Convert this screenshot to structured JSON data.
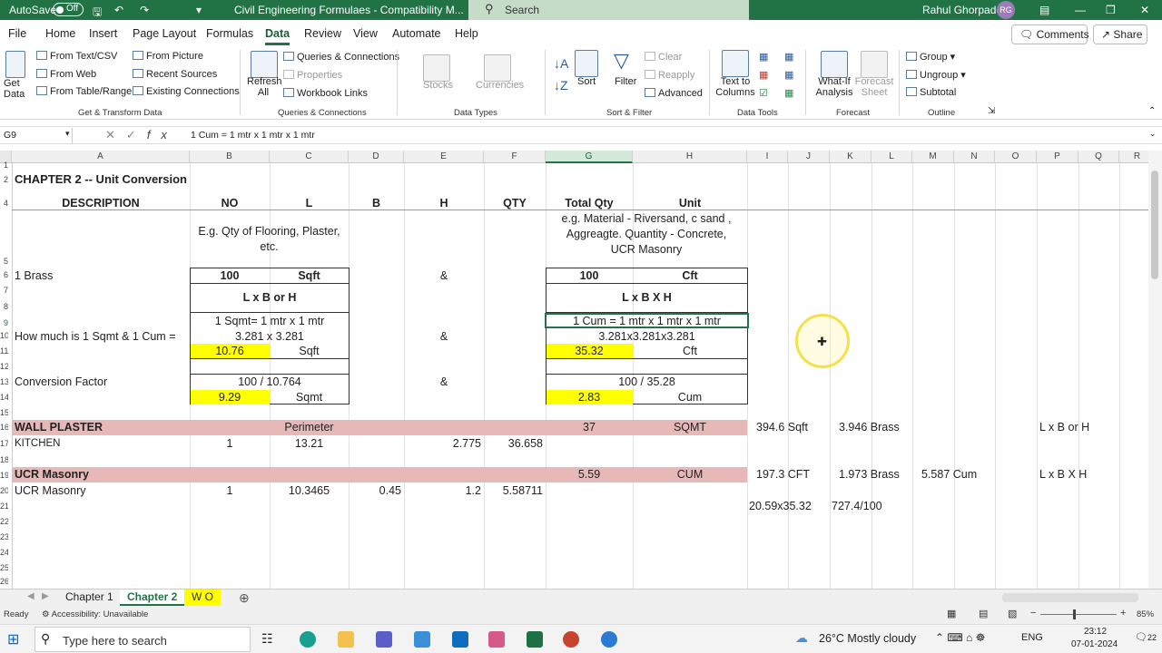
{
  "titlebar": {
    "autosave_label": "AutoSave",
    "autosave_state": "Off",
    "doc_title": "Civil Engineering Formulaes  -  Compatibility M...",
    "search_placeholder": "Search",
    "user_name": "Rahul  Ghorpade",
    "user_initials": "RG"
  },
  "menu": {
    "items": [
      "File",
      "Home",
      "Insert",
      "Page Layout",
      "Formulas",
      "Data",
      "Review",
      "View",
      "Automate",
      "Help"
    ],
    "active": "Data",
    "comments_label": "Comments",
    "share_label": "Share"
  },
  "ribbon": {
    "get_data": "Get Data",
    "from_text": "From Text/CSV",
    "from_web": "From Web",
    "from_table": "From Table/Range",
    "from_picture": "From Picture",
    "recent_sources": "Recent Sources",
    "existing_connections": "Existing Connections",
    "group_get_transform": "Get & Transform Data",
    "refresh_all": "Refresh All",
    "queries_connections": "Queries & Connections",
    "properties": "Properties",
    "workbook_links": "Workbook Links",
    "group_queries": "Queries & Connections",
    "stocks": "Stocks",
    "currencies": "Currencies",
    "group_data_types": "Data Types",
    "sort": "Sort",
    "filter": "Filter",
    "clear": "Clear",
    "reapply": "Reapply",
    "advanced": "Advanced",
    "group_sort_filter": "Sort & Filter",
    "text_to_columns": "Text to Columns",
    "group_data_tools": "Data Tools",
    "what_if": "What-If Analysis",
    "forecast_sheet": "Forecast Sheet",
    "group_forecast": "Forecast",
    "group": "Group",
    "ungroup": "Ungroup",
    "subtotal": "Subtotal",
    "group_outline": "Outline"
  },
  "formula_bar": {
    "name_box": "G9",
    "formula": "1 Cum =  1 mtr x 1 mtr x 1 mtr"
  },
  "columns": [
    "A",
    "B",
    "C",
    "D",
    "E",
    "F",
    "G",
    "H",
    "I",
    "J",
    "K",
    "L",
    "M",
    "N",
    "O",
    "P",
    "Q",
    "R"
  ],
  "rows": [
    "1",
    "2",
    "4",
    "5",
    "6",
    "7",
    "8",
    "9",
    "10",
    "11",
    "12",
    "13",
    "14",
    "15",
    "16",
    "17",
    "18",
    "19",
    "20",
    "21",
    "22",
    "23",
    "24",
    "25",
    "26"
  ],
  "sheet": {
    "title": "CHAPTER 2 -- Unit Conversion",
    "h_desc": "DESCRIPTION",
    "h_no": "NO",
    "h_l": "L",
    "h_b": "B",
    "h_h": "H",
    "h_qty": "QTY",
    "h_total": "Total Qty",
    "h_unit": "Unit",
    "eg_left": [
      "E.g. Qty of Flooring, Plaster,",
      "etc."
    ],
    "eg_right": [
      "e.g.  Material - Riversand, c sand ,",
      "Aggreagte. Quantity - Concrete,",
      "UCR Masonry"
    ],
    "brass": "1 Brass",
    "v100a": "100",
    "sqft": "Sqft",
    "amp": "&",
    "v100b": "100",
    "cft": "Cft",
    "lxb_h": "L x B or H",
    "lxbxh": "L x B X H",
    "sqmt_def": "1 Sqmt=  1 mtr x 1 mtr",
    "cum_def": "1 Cum =  1 mtr x 1 mtr x 1 mtr",
    "how_much": "How much is 1 Sqmt & 1 Cum =",
    "sq_calc": "3.281 x 3.281",
    "cu_calc": "3.281x3.281x3.281",
    "v1076": "10.76",
    "sqft2": "Sqft",
    "v3532": "35.32",
    "cft2": "Cft",
    "conv": "Conversion Factor",
    "div1": "100 / 10.764",
    "div2": "100 / 35.28",
    "v929": "9.29",
    "sqmt": "Sqmt",
    "v283": "2.83",
    "cum": "Cum",
    "wall": "WALL PLASTER",
    "perimeter": "Perimeter",
    "v37": "37",
    "sqmt_u": "SQMT",
    "i16": "394.6  Sqft",
    "k16": "3.946  Brass",
    "p16": "L x B or H",
    "kitchen": "KITCHEN",
    "k_no": "1",
    "k_l": "13.21",
    "k_h": "2.775",
    "k_qty": "36.658",
    "ucr": "UCR Masonry",
    "v559": "5.59",
    "cum_u": "CUM",
    "i19": "197.3  CFT",
    "k19": "1.973  Brass",
    "m19": "5.587  Cum",
    "p19": "L x B X H",
    "ucr2": "UCR Masonry",
    "u_no": "1",
    "u_l": "10.3465",
    "u_b": "0.45",
    "u_h": "1.2",
    "u_qty": "5.58711",
    "i21": "20.59x35.32",
    "k21": "727.4/100"
  },
  "tabs": [
    "Chapter 1",
    "Chapter 2",
    "W O"
  ],
  "active_tab": "Chapter 2",
  "status": {
    "ready": "Ready",
    "accessibility": "Accessibility: Unavailable",
    "zoom": "85%"
  },
  "taskbar": {
    "search": "Type here to search",
    "weather": "26°C  Mostly cloudy",
    "lang": "ENG",
    "time": "23:12",
    "date": "07-01-2024",
    "notif": "22"
  }
}
